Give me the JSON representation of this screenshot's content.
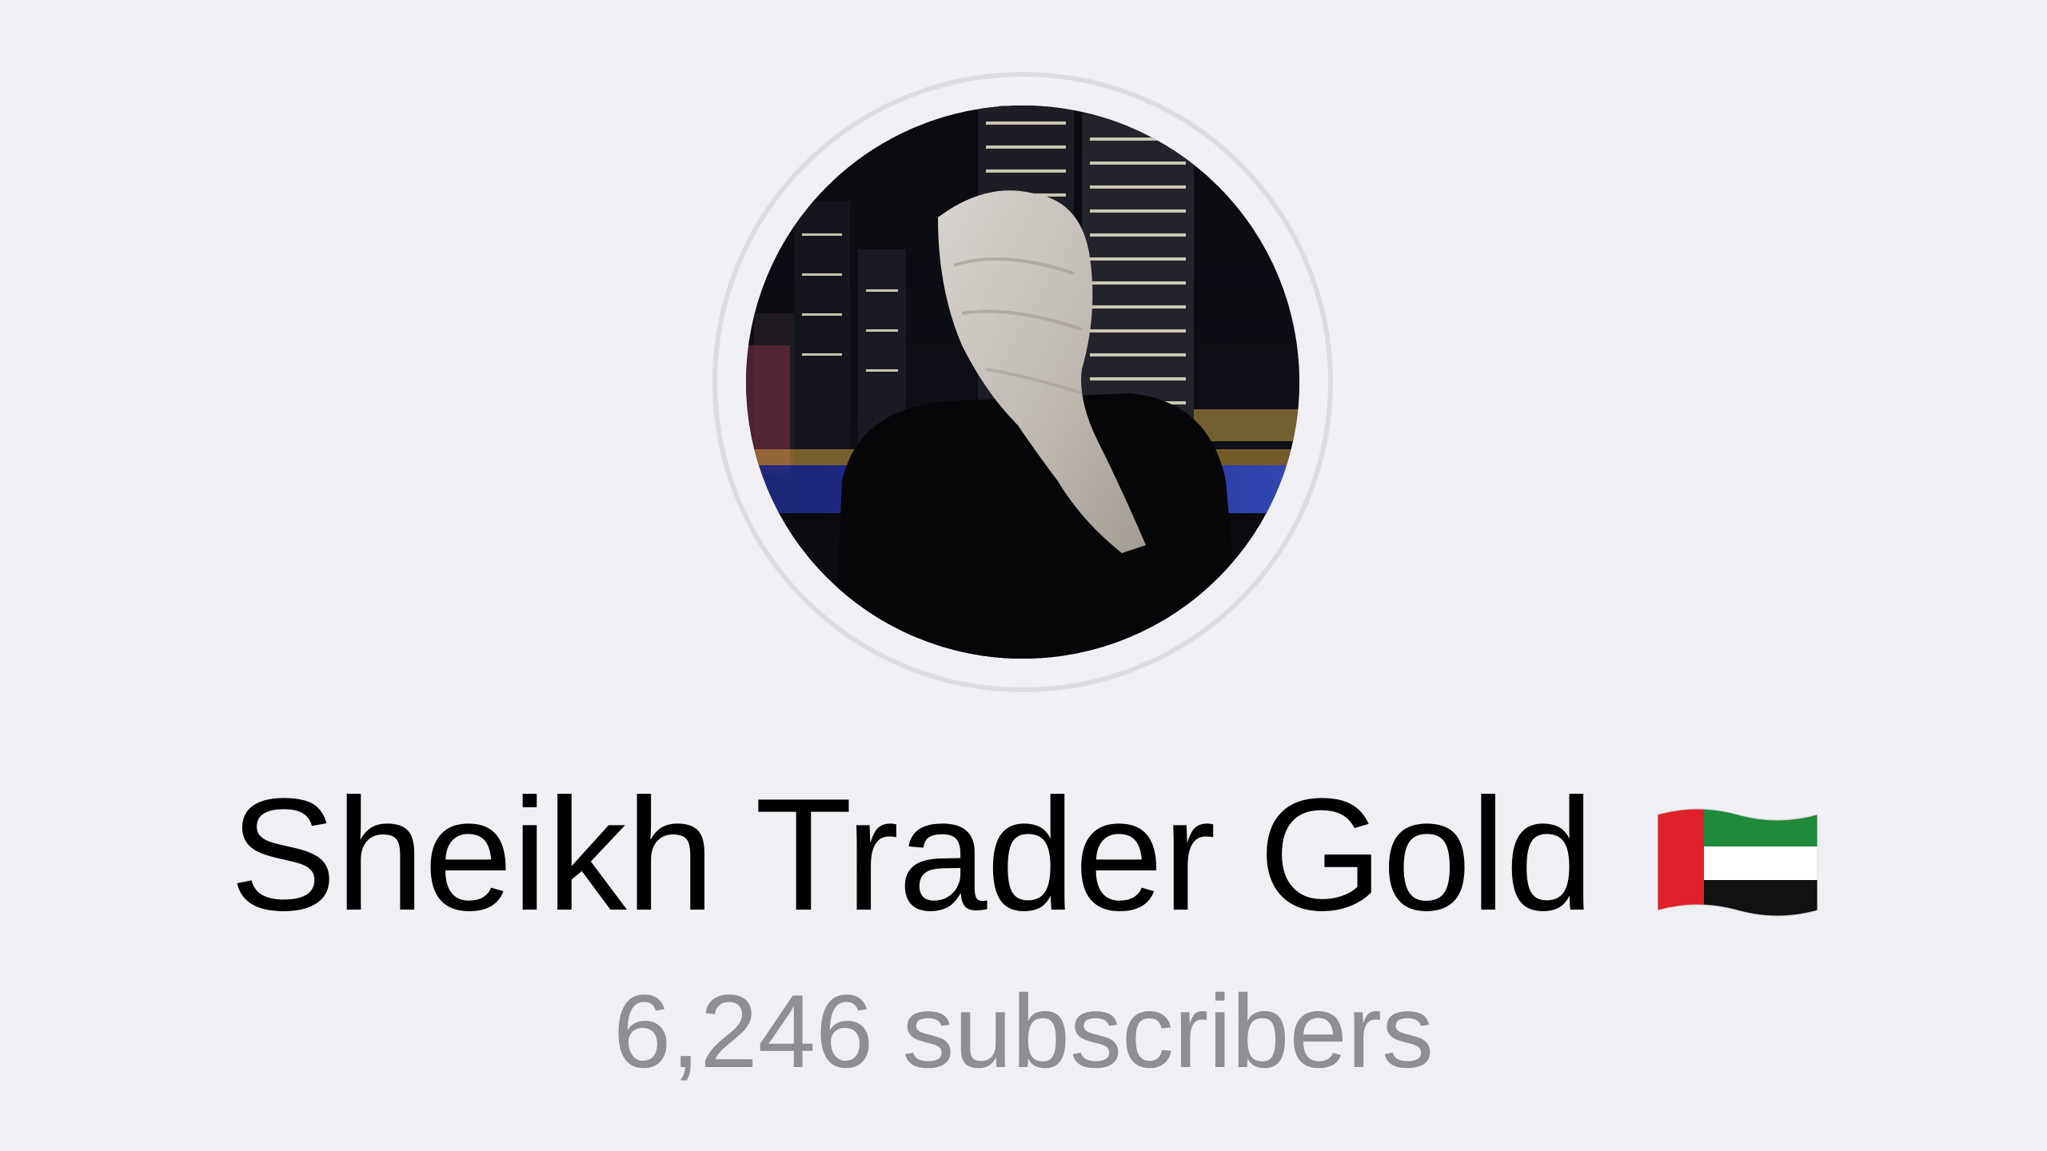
{
  "profile": {
    "channel_name": "Sheikh Trader Gold",
    "subscribers": "6,246 subscribers",
    "name_flag_icon": "uae-flag-icon",
    "avatar_icon": "profile-photo"
  },
  "colors": {
    "background": "#efeff4",
    "name_text": "#000000",
    "subtitle_text": "#8e8e93",
    "avatar_ring": "#dcdce0"
  }
}
